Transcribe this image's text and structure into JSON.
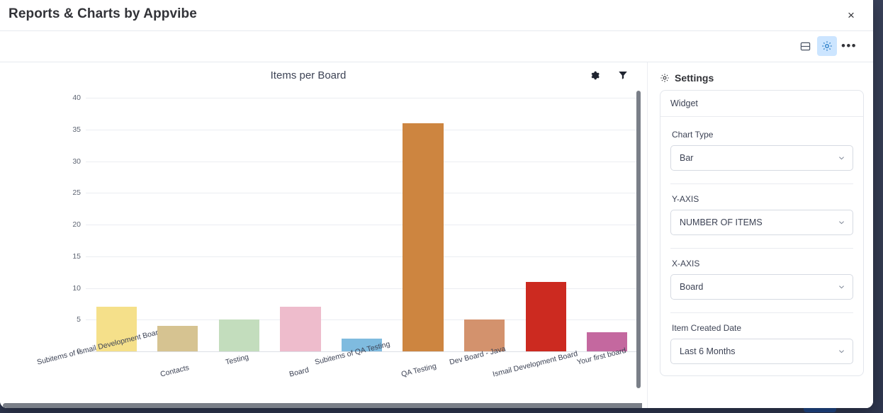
{
  "window": {
    "title": "Reports & Charts by Appvibe",
    "close_label": "×"
  },
  "toolbar": {
    "layout_icon": "split-layout-icon",
    "settings_icon": "gear-icon",
    "more_icon": "•••"
  },
  "chart_panel": {
    "gear_icon": "gear-icon",
    "filter_icon": "filter-icon"
  },
  "settings": {
    "header": "Settings",
    "header_icon": "gear-icon",
    "widget_label": "Widget",
    "fields": [
      {
        "label": "Chart Type",
        "value": "Bar"
      },
      {
        "label": "Y-AXIS",
        "value": "NUMBER OF ITEMS"
      },
      {
        "label": "X-AXIS",
        "value": "Board"
      },
      {
        "label": "Item Created Date",
        "value": "Last 6 Months"
      }
    ]
  },
  "chart_data": {
    "type": "bar",
    "title": "Items per Board",
    "xlabel": "",
    "ylabel": "",
    "ylim": [
      0,
      40
    ],
    "yticks": [
      0,
      5,
      10,
      15,
      20,
      25,
      30,
      35,
      40
    ],
    "grid": true,
    "legend": "none",
    "categories": [
      "Subitems of Ismail Development Board",
      "Contacts",
      "Testing",
      "Board",
      "Subitems of QA Testing",
      "QA Testing",
      "Dev Board - Java",
      "Ismail Development Board",
      "Your first board"
    ],
    "values": [
      7,
      4,
      5,
      7,
      2,
      36,
      5,
      11,
      3
    ],
    "colors": [
      "#f5e08a",
      "#d6c391",
      "#c3ddbd",
      "#eebccc",
      "#7fbbdf",
      "#cd8540",
      "#d3926d",
      "#cc2a20",
      "#c4689f"
    ]
  }
}
